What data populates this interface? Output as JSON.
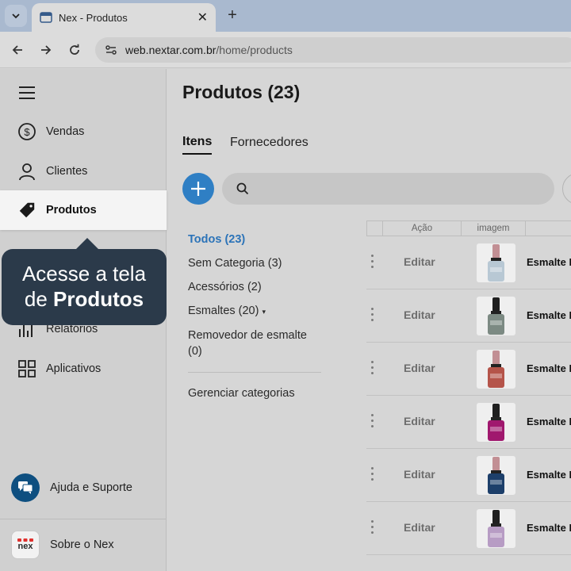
{
  "browser": {
    "tab_title": "Nex - Produtos",
    "url_host": "web.nextar.com.br",
    "url_path": "/home/products"
  },
  "sidebar": {
    "items": [
      {
        "label": "Vendas",
        "icon": "dollar-circle-icon"
      },
      {
        "label": "Clientes",
        "icon": "user-icon"
      },
      {
        "label": "Produtos",
        "icon": "tag-icon",
        "active": true
      },
      {
        "label": "Relatórios",
        "icon": "bar-chart-icon"
      },
      {
        "label": "Aplicativos",
        "icon": "grid-icon"
      }
    ],
    "help_label": "Ajuda e Suporte",
    "about_label": "Sobre o Nex",
    "logo_text": "nex"
  },
  "tooltip": {
    "line1": "Acesse a tela",
    "line2_prefix": "de",
    "line2_bold": "Produtos"
  },
  "main": {
    "title": "Produtos (23)",
    "tabs": [
      {
        "label": "Itens",
        "active": true
      },
      {
        "label": "Fornecedores"
      }
    ],
    "categories": [
      {
        "label": "Todos (23)",
        "active": true
      },
      {
        "label": "Sem Categoria (3)"
      },
      {
        "label": "Acessórios (2)"
      },
      {
        "label": "Esmaltes (20)",
        "caret": "▾"
      },
      {
        "label": "Removedor de esmalte (0)"
      }
    ],
    "manage_categories": "Gerenciar categorias",
    "table": {
      "headers": [
        "Ação",
        "imagem"
      ],
      "rows": [
        {
          "action": "Editar",
          "name": "Esmalte R",
          "color": "#b8c8d4",
          "cap": "#c28f94"
        },
        {
          "action": "Editar",
          "name": "Esmalte R",
          "color": "#7c8a83",
          "cap": "#1f1f1f"
        },
        {
          "action": "Editar",
          "name": "Esmalte R",
          "color": "#b5544a",
          "cap": "#c28f94"
        },
        {
          "action": "Editar",
          "name": "Esmalte R",
          "color": "#a0186e",
          "cap": "#1f1f1f"
        },
        {
          "action": "Editar",
          "name": "Esmalte R",
          "color": "#1d3f6a",
          "cap": "#c28f94"
        },
        {
          "action": "Editar",
          "name": "Esmalte R",
          "color": "#b79cc4",
          "cap": "#1f1f1f"
        }
      ]
    }
  },
  "colors": {
    "accent": "#2f7fc4",
    "tooltip_bg": "#2b3a4a",
    "help_circle": "#0e4f80",
    "nex_red": "#e0312e"
  }
}
